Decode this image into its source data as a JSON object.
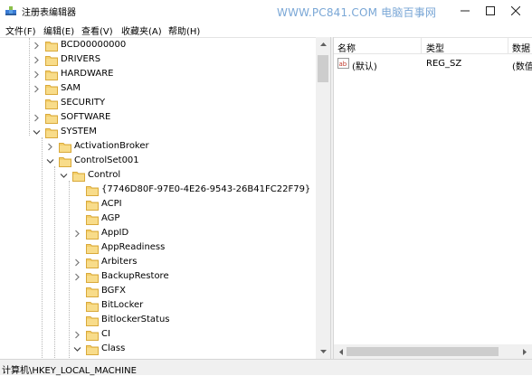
{
  "window": {
    "title": "注册表编辑器",
    "watermark": "WWW.PC841.COM 电脑百事网"
  },
  "menu": [
    {
      "label": "文件(F)"
    },
    {
      "label": "编辑(E)"
    },
    {
      "label": "查看(V)"
    },
    {
      "label": "收藏夹(A)"
    },
    {
      "label": "帮助(H)"
    }
  ],
  "tree": [
    {
      "label": "BCD00000000",
      "level": 0,
      "expander": "collapsed"
    },
    {
      "label": "DRIVERS",
      "level": 0,
      "expander": "collapsed"
    },
    {
      "label": "HARDWARE",
      "level": 0,
      "expander": "collapsed"
    },
    {
      "label": "SAM",
      "level": 0,
      "expander": "collapsed"
    },
    {
      "label": "SECURITY",
      "level": 0,
      "expander": "none"
    },
    {
      "label": "SOFTWARE",
      "level": 0,
      "expander": "collapsed"
    },
    {
      "label": "SYSTEM",
      "level": 0,
      "expander": "expanded"
    },
    {
      "label": "ActivationBroker",
      "level": 1,
      "expander": "collapsed"
    },
    {
      "label": "ControlSet001",
      "level": 1,
      "expander": "expanded"
    },
    {
      "label": "Control",
      "level": 2,
      "expander": "expanded"
    },
    {
      "label": "{7746D80F-97E0-4E26-9543-26B41FC22F79}",
      "level": 3,
      "expander": "none"
    },
    {
      "label": "ACPI",
      "level": 3,
      "expander": "none"
    },
    {
      "label": "AGP",
      "level": 3,
      "expander": "none"
    },
    {
      "label": "AppID",
      "level": 3,
      "expander": "collapsed"
    },
    {
      "label": "AppReadiness",
      "level": 3,
      "expander": "none"
    },
    {
      "label": "Arbiters",
      "level": 3,
      "expander": "collapsed"
    },
    {
      "label": "BackupRestore",
      "level": 3,
      "expander": "collapsed"
    },
    {
      "label": "BGFX",
      "level": 3,
      "expander": "none"
    },
    {
      "label": "BitLocker",
      "level": 3,
      "expander": "none"
    },
    {
      "label": "BitlockerStatus",
      "level": 3,
      "expander": "none"
    },
    {
      "label": "CI",
      "level": 3,
      "expander": "collapsed"
    },
    {
      "label": "Class",
      "level": 3,
      "expander": "expanded"
    }
  ],
  "list": {
    "columns": [
      "名称",
      "类型",
      "数据"
    ],
    "rows": [
      {
        "name": "(默认)",
        "type": "REG_SZ",
        "data": "(数值"
      }
    ]
  },
  "status": {
    "path": "计算机\\HKEY_LOCAL_MACHINE"
  },
  "colors": {
    "folder": "#f4cf6b",
    "folder_dark": "#d9a93a",
    "watermark": "#7aa7d6"
  }
}
